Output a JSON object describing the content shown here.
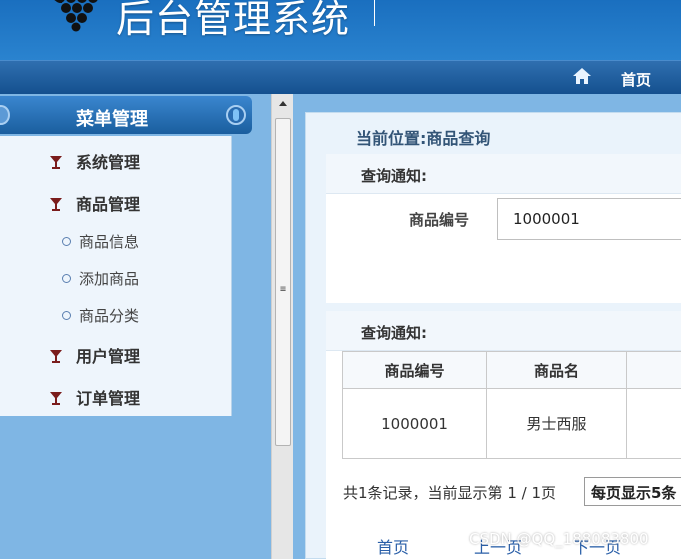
{
  "header": {
    "title": "后台管理系统"
  },
  "navbar": {
    "home_label": "首页"
  },
  "sidebar": {
    "title": "菜单管理",
    "items": [
      {
        "label": "系统管理"
      },
      {
        "label": "商品管理",
        "children": [
          "商品信息",
          "添加商品",
          "商品分类"
        ]
      },
      {
        "label": "用户管理"
      },
      {
        "label": "订单管理"
      }
    ]
  },
  "content": {
    "location": "当前位置:商品查询",
    "search_panel": {
      "heading": "查询通知:",
      "field_label": "商品编号",
      "field_value": "1000001"
    },
    "result_panel": {
      "heading": "查询通知:",
      "columns": [
        "商品编号",
        "商品名"
      ],
      "rows": [
        [
          "1000001",
          "男士西服"
        ]
      ],
      "pager_info": "共1条记录，当前显示第 1 / 1页",
      "page_size_label": "每页显示5条",
      "pager_links": [
        "首页",
        "上一页",
        "下一页"
      ]
    }
  },
  "watermark": "CSDN @QQ_188083800",
  "colors": {
    "header": "#1a6fbf",
    "navbar": "#14508f",
    "background": "#7fb6e4"
  }
}
